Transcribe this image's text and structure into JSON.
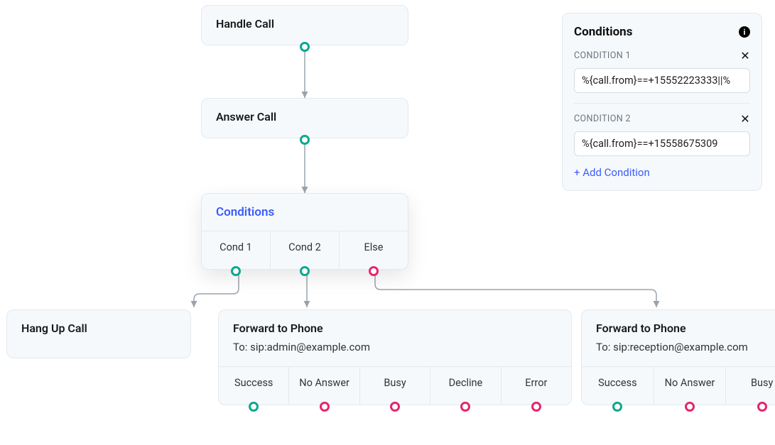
{
  "nodes": {
    "handle": {
      "title": "Handle Call"
    },
    "answer": {
      "title": "Answer Call"
    },
    "conditions": {
      "title": "Conditions",
      "branches": {
        "c1": "Cond 1",
        "c2": "Cond 2",
        "else": "Else"
      }
    },
    "hangup": {
      "title": "Hang Up Call"
    },
    "fwd1": {
      "title": "Forward to Phone",
      "to": "To: sip:admin@example.com",
      "outcomes": {
        "success": "Success",
        "noanswer": "No Answer",
        "busy": "Busy",
        "decline": "Decline",
        "error": "Error"
      }
    },
    "fwd2": {
      "title": "Forward to Phone",
      "to": "To: sip:reception@example.com",
      "outcomes": {
        "success": "Success",
        "noanswer": "No Answer",
        "busy": "Busy"
      }
    }
  },
  "panel": {
    "title": "Conditions",
    "conditions": {
      "c1": {
        "label": "CONDITION 1",
        "value": "%{call.from}==+15552223333||%"
      },
      "c2": {
        "label": "CONDITION 2",
        "value": "%{call.from}==+15558675309"
      }
    },
    "add": "+ Add Condition"
  },
  "colors": {
    "accent_blue": "#3b5cff",
    "port_green": "#0aa88f",
    "port_pink": "#e6256e"
  }
}
